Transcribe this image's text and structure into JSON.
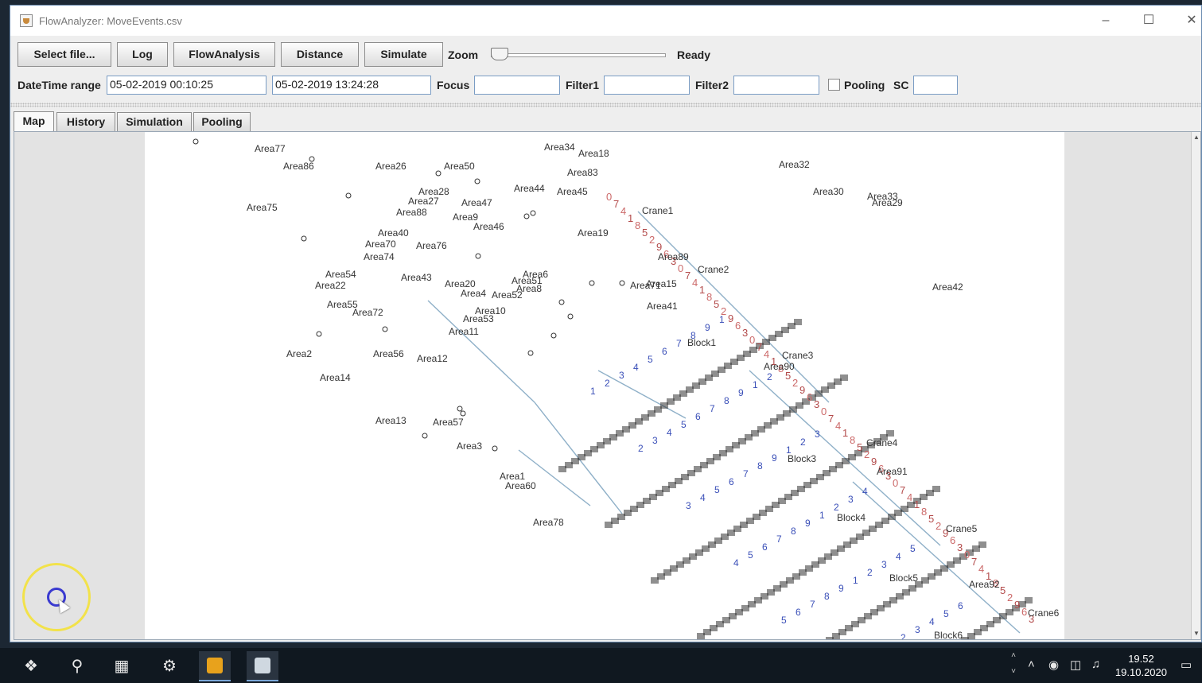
{
  "window": {
    "title": "FlowAnalyzer: MoveEvents.csv"
  },
  "toolbar": {
    "select_file": "Select file...",
    "log": "Log",
    "flow_analysis": "FlowAnalysis",
    "distance": "Distance",
    "simulate": "Simulate",
    "zoom_label": "Zoom",
    "zoom_level": 0,
    "status": "Ready"
  },
  "filters": {
    "datetime_label": "DateTime range",
    "start": "05-02-2019 00:10:25",
    "end": "05-02-2019 13:24:28",
    "focus_label": "Focus",
    "focus_value": "",
    "filter1_label": "Filter1",
    "filter1_value": "",
    "filter2_label": "Filter2",
    "filter2_value": "",
    "pooling_label": "Pooling",
    "pooling_checked": false,
    "sc_label": "SC",
    "sc_value": ""
  },
  "tabs": [
    "Map",
    "History",
    "Simulation",
    "Pooling"
  ],
  "active_tab": "Map",
  "map": {
    "areas": [
      "Area77",
      "Area86",
      "Area26",
      "Area50",
      "Area34",
      "Area18",
      "Area83",
      "Area32",
      "Area28",
      "Area27",
      "Area47",
      "Area75",
      "Area88",
      "Area9",
      "Area44",
      "Area45",
      "Area30",
      "Area33",
      "Area29",
      "Area40",
      "Area46",
      "Area19",
      "Area70",
      "Area76",
      "Area74",
      "Area89",
      "Area54",
      "Area43",
      "Area20",
      "Area6",
      "Area51",
      "Area22",
      "Area4",
      "Area52",
      "Area8",
      "Area71",
      "Area15",
      "Area42",
      "Area55",
      "Area72",
      "Area10",
      "Area53",
      "Area41",
      "Area11",
      "Area2",
      "Area56",
      "Area12",
      "Area14",
      "Area13",
      "Area57",
      "Area3",
      "Area1",
      "Area60",
      "Area78",
      "Area91",
      "Area92",
      "Area90"
    ],
    "cranes": [
      "Crane1",
      "Crane2",
      "Crane3",
      "Crane4",
      "Crane5",
      "Crane6"
    ],
    "blocks": [
      "Block1",
      "Block3",
      "Block4",
      "Block5",
      "Block6"
    ],
    "colors": {
      "flow_red": "#b34a4a",
      "flow_blue": "#3a4fb8",
      "edge": "#8fb0c8",
      "block_fill": "#333333"
    }
  },
  "taskbar": {
    "time": "19.52",
    "date": "19.10.2020",
    "icons": [
      "windows-start-icon",
      "search-icon",
      "task-view-icon",
      "settings-icon",
      "media-player-icon",
      "java-app-icon"
    ]
  }
}
